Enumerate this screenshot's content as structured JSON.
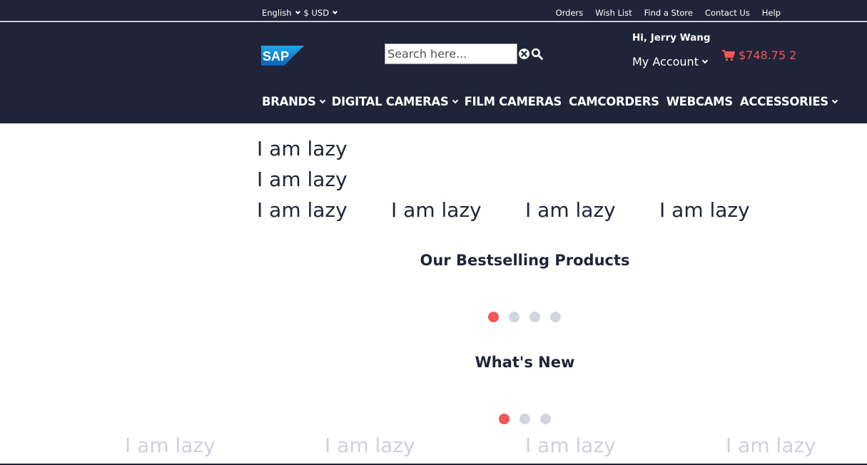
{
  "topbar": {
    "language": "English",
    "currency": "$ USD",
    "links": [
      "Orders",
      "Wish List",
      "Find a Store",
      "Contact Us",
      "Help"
    ]
  },
  "header": {
    "logo_text": "SAP",
    "search_placeholder": "Search here...",
    "greeting": "Hi, Jerry Wang",
    "account_label": "My Account",
    "cart_total": "$748.75",
    "cart_count": "2"
  },
  "nav": [
    "BRANDS",
    "DIGITAL CAMERAS",
    "FILM CAMERAS",
    "CAMCORDERS",
    "WEBCAMS",
    "ACCESSORIES"
  ],
  "lazy_text": "I am lazy",
  "sections": {
    "bestselling_title": "Our Bestselling Products",
    "whats_new_title": "What's New"
  },
  "colors": {
    "navy": "#1f2438",
    "accent": "#f25656",
    "dot_inactive": "#d3d5dc"
  }
}
